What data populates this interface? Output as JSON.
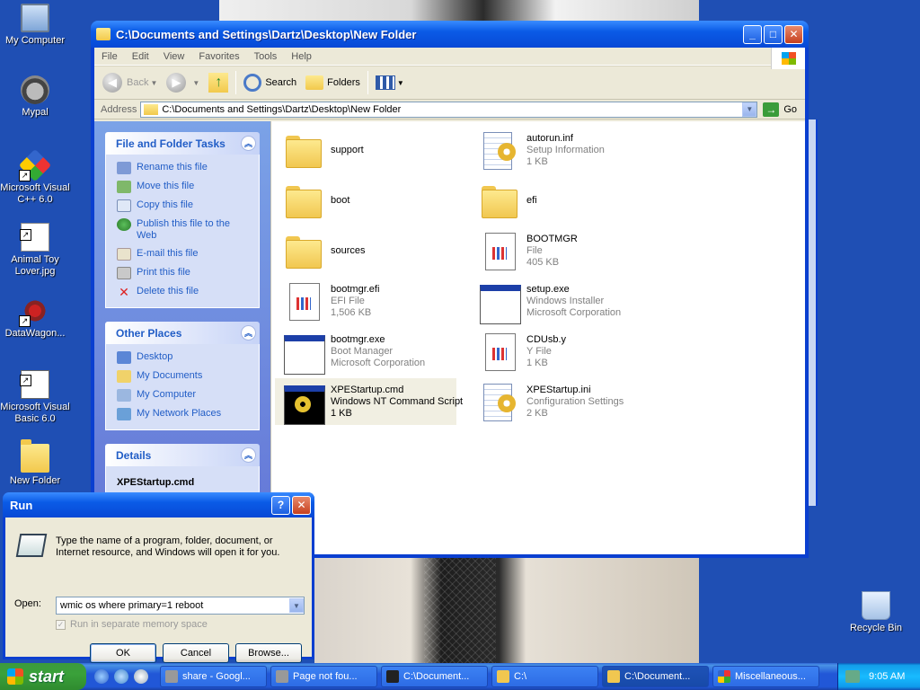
{
  "desktop": {
    "icons": [
      {
        "label": "My Computer",
        "icon": "my-computer-icon"
      },
      {
        "label": "Mypal",
        "icon": "mypal-icon"
      },
      {
        "label": "Microsoft Visual C++ 6.0",
        "icon": "visual-cpp-icon"
      },
      {
        "label": "Animal Toy Lover.jpg",
        "icon": "jpg-image-icon"
      },
      {
        "label": "DataWagon...",
        "icon": "datawagon-icon"
      },
      {
        "label": "Microsoft Visual Basic 6.0",
        "icon": "visual-basic-icon"
      },
      {
        "label": "New Folder",
        "icon": "folder-icon"
      },
      {
        "label": "Recycle Bin",
        "icon": "recycle-bin-icon"
      }
    ]
  },
  "explorer": {
    "title": "C:\\Documents and Settings\\Dartz\\Desktop\\New Folder",
    "menu": [
      "File",
      "Edit",
      "View",
      "Favorites",
      "Tools",
      "Help"
    ],
    "toolbar": {
      "back": "Back",
      "search": "Search",
      "folders": "Folders"
    },
    "address": {
      "label": "Address",
      "value": "C:\\Documents and Settings\\Dartz\\Desktop\\New Folder",
      "go": "Go"
    },
    "tasks": {
      "file_folder": {
        "title": "File and Folder Tasks",
        "items": [
          "Rename this file",
          "Move this file",
          "Copy this file",
          "Publish this file to the Web",
          "E-mail this file",
          "Print this file",
          "Delete this file"
        ]
      },
      "other_places": {
        "title": "Other Places",
        "items": [
          "Desktop",
          "My Documents",
          "My Computer",
          "My Network Places"
        ]
      },
      "details": {
        "title": "Details",
        "name": "XPEStartup.cmd"
      }
    },
    "files": [
      {
        "name": "support",
        "type": "",
        "size": "",
        "icon": "folder"
      },
      {
        "name": "autorun.inf",
        "type": "Setup Information",
        "size": "1 KB",
        "icon": "setup-info"
      },
      {
        "name": "boot",
        "type": "",
        "size": "",
        "icon": "folder"
      },
      {
        "name": "efi",
        "type": "",
        "size": "",
        "icon": "folder"
      },
      {
        "name": "sources",
        "type": "",
        "size": "",
        "icon": "folder"
      },
      {
        "name": "BOOTMGR",
        "type": "File",
        "size": "405 KB",
        "icon": "generic-file"
      },
      {
        "name": "bootmgr.efi",
        "type": "EFI File",
        "size": "1,506 KB",
        "icon": "generic-file"
      },
      {
        "name": "setup.exe",
        "type": "Windows Installer",
        "size": "Microsoft Corporation",
        "icon": "application"
      },
      {
        "name": "bootmgr.exe",
        "type": "Boot Manager",
        "size": "Microsoft Corporation",
        "icon": "application"
      },
      {
        "name": "CDUsb.y",
        "type": "Y File",
        "size": "1 KB",
        "icon": "generic-file"
      },
      {
        "name": "XPEStartup.cmd",
        "type": "Windows NT Command Script",
        "size": "1 KB",
        "icon": "command-script",
        "selected": true
      },
      {
        "name": "XPEStartup.ini",
        "type": "Configuration Settings",
        "size": "2 KB",
        "icon": "setup-info"
      }
    ]
  },
  "run": {
    "title": "Run",
    "description": "Type the name of a program, folder, document, or Internet resource, and Windows will open it for you.",
    "open_label": "Open:",
    "open_value": "wmic os where primary=1 reboot",
    "checkbox": "Run in separate memory space",
    "ok": "OK",
    "cancel": "Cancel",
    "browse": "Browse..."
  },
  "taskbar": {
    "start": "start",
    "buttons": [
      "share - Googl...",
      "Page not fou...",
      "C:\\Document...",
      "C:\\",
      "C:\\Document...",
      "Miscellaneous..."
    ],
    "clock": "9:05 AM"
  }
}
